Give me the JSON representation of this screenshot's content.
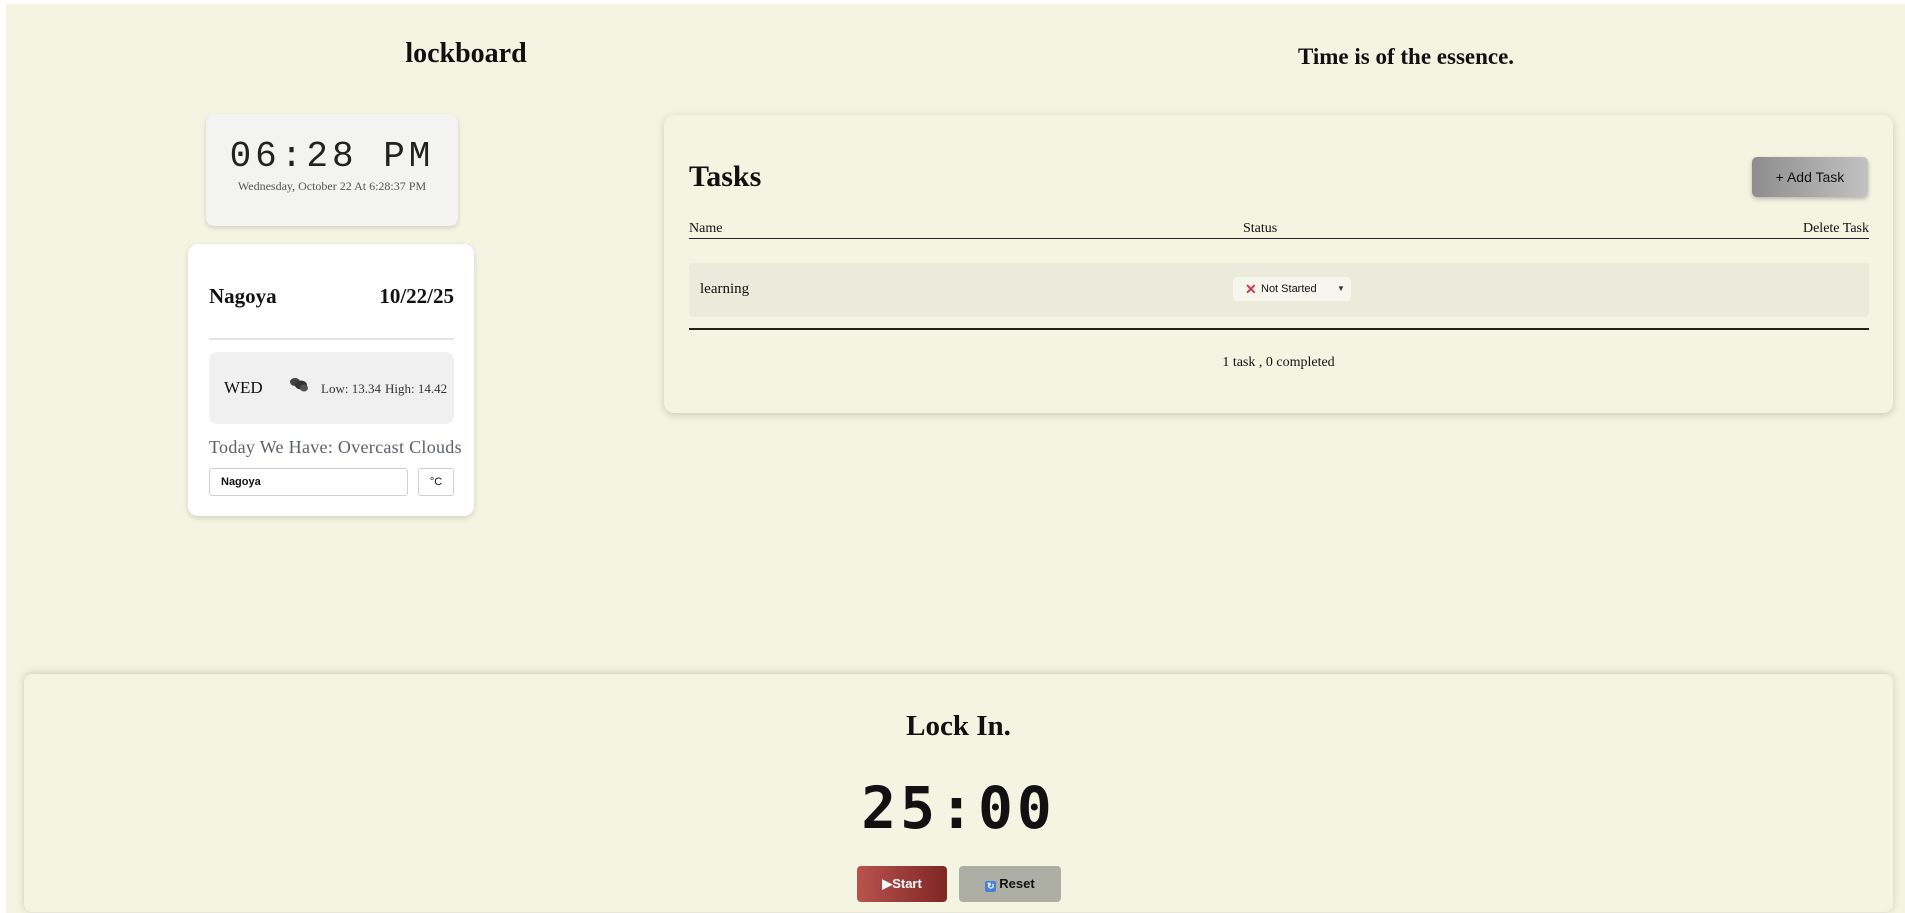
{
  "header": {
    "app_title": "lockboard",
    "tagline": "Time is of the essence."
  },
  "clock": {
    "time": "06:28 PM",
    "date": "Wednesday, October 22 At 6:28:37 PM"
  },
  "weather": {
    "city": "Nagoya",
    "date": "10/22/25",
    "day": "WED",
    "icon": "cloud-icon",
    "low": "Low: 13.34",
    "high": "High: 14.42",
    "summary": "Today We Have: Overcast Clouds",
    "city_input_value": "Nagoya",
    "unit_button": "°C"
  },
  "tasks": {
    "title": "Tasks",
    "add_button": "+ Add Task",
    "columns": [
      "Name",
      "Status",
      "Delete Task"
    ],
    "rows": [
      {
        "name": "learning",
        "status": "Not Started"
      }
    ],
    "summary": "1 task , 0 completed"
  },
  "timer": {
    "title": "Lock In.",
    "display": "25:00",
    "start_label": "Start",
    "reset_label": "Reset"
  },
  "colors": {
    "page_background": "#f3f4e2",
    "start_button": "#9a3a35",
    "reset_button": "#aeafa4",
    "status_x": "#d6364a"
  }
}
